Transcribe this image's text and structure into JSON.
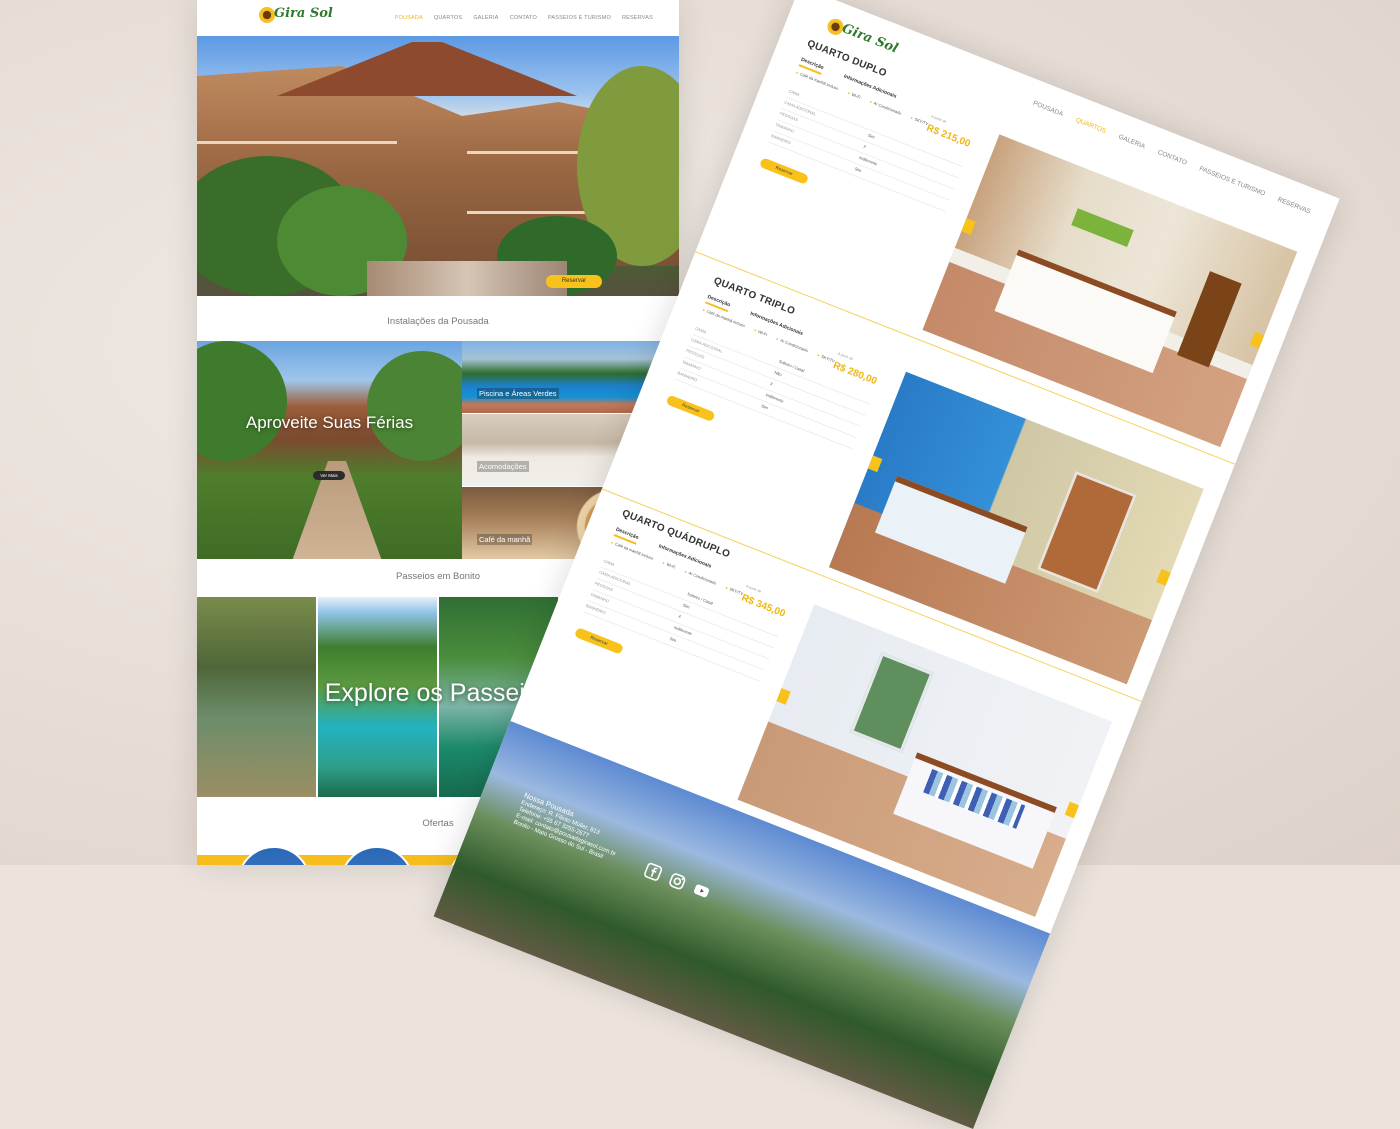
{
  "left": {
    "logo_text": "Gira Sol",
    "menu": [
      "POUSADA",
      "QUARTOS",
      "GALERIA",
      "CONTATO",
      "PASSEIOS E TURISMO",
      "RESERVAS"
    ],
    "active_menu": "POUSADA",
    "hero_button": "Reservar",
    "section_installations": "Instalações da Pousada",
    "big_tile_title": "Aproveite Suas Férias",
    "big_tile_button": "Ver Mais",
    "tiles": [
      "Piscina e Áreas Verdes",
      "Acomodações",
      "Café da manhã"
    ],
    "section_tours": "Passeios em Bonito",
    "tours_title": "Explore os Passeios",
    "section_offers": "Ofertas"
  },
  "right": {
    "logo_text": "Gira Sol",
    "menu": [
      "POUSADA",
      "QUARTOS",
      "GALERIA",
      "CONTATO",
      "PASSEIOS E TURISMO",
      "RESERVAS"
    ],
    "active_menu": "QUARTOS",
    "rooms": [
      {
        "title": "QUARTO DUPLO",
        "tabs": [
          "Descrição",
          "Informações Adicionais"
        ],
        "features": [
          "Café da manhã incluso",
          "Wi-Fi",
          "Ar Condicionado",
          "SKY/TV"
        ],
        "price_label": "A partir de",
        "price": "R$ 215,00",
        "rows": [
          {
            "k": "CAMA",
            "v": ""
          },
          {
            "k": "CAMA ADICIONAL",
            "v": "Sim"
          },
          {
            "k": "PESSOAS",
            "v": "2"
          },
          {
            "k": "TAMANHO",
            "v": "Indiferente"
          },
          {
            "k": "BANHEIRO",
            "v": "Sim"
          }
        ],
        "button": "Reservar"
      },
      {
        "title": "QUARTO TRIPLO",
        "tabs": [
          "Descrição",
          "Informações Adicionais"
        ],
        "features": [
          "Café da manhã incluso",
          "Wi-Fi",
          "Ar Condicionado",
          "SKY/TV"
        ],
        "price_label": "A partir de",
        "price": "R$ 280,00",
        "rows": [
          {
            "k": "CAMA",
            "v": "Solteiro / Casal"
          },
          {
            "k": "CAMA ADICIONAL",
            "v": "Não"
          },
          {
            "k": "PESSOAS",
            "v": "3"
          },
          {
            "k": "TAMANHO",
            "v": "Indiferente"
          },
          {
            "k": "BANHEIRO",
            "v": "Sim"
          }
        ],
        "button": "Reservar"
      },
      {
        "title": "QUARTO QUÁDRUPLO",
        "tabs": [
          "Descrição",
          "Informações Adicionais"
        ],
        "features": [
          "Café da manhã incluso",
          "Wi-Fi",
          "Ar Condicionado",
          "SKY/TV"
        ],
        "price_label": "A partir de",
        "price": "R$ 345,00",
        "rows": [
          {
            "k": "CAMA",
            "v": "Solteiro / Casal"
          },
          {
            "k": "CAMA ADICIONAL",
            "v": "Sim"
          },
          {
            "k": "PESSOAS",
            "v": "4"
          },
          {
            "k": "TAMANHO",
            "v": "Indiferente"
          },
          {
            "k": "BANHEIRO",
            "v": "Sim"
          }
        ],
        "button": "Reservar"
      }
    ],
    "footer": {
      "title": "Nossa Pousada",
      "address": "Endereço: R. Filinto Müller, 813",
      "phone": "Telefone: +55 67 3255-2677",
      "email": "E-mail: contato@pousadagirasol.com.br",
      "city": "Bonito - Mato Grosso do Sul - Brasil"
    }
  },
  "colors": {
    "accent": "#f8c21a",
    "brand_green": "#2f7a2c"
  }
}
